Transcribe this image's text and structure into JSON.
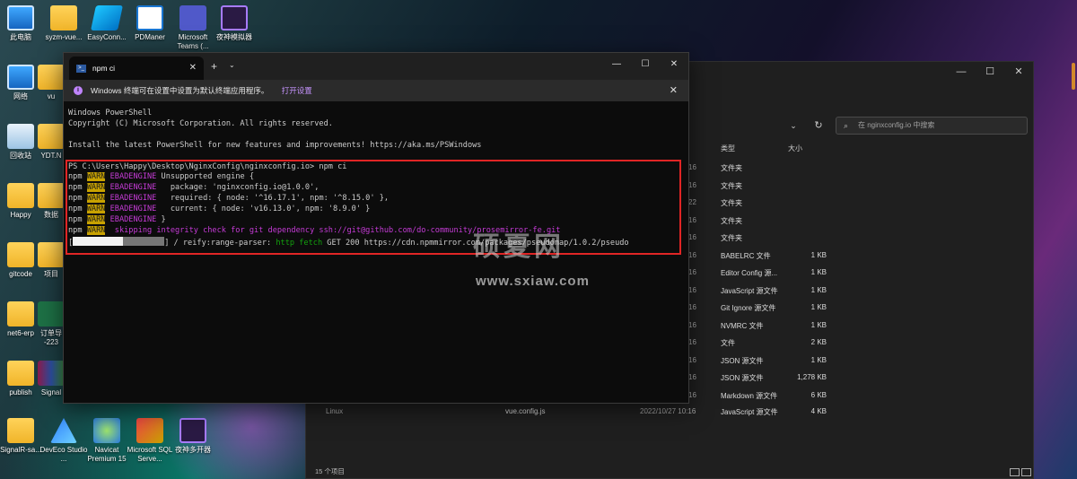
{
  "desktop": {
    "icons": [
      {
        "label": "此电脑",
        "icon": "monitor-icon"
      },
      {
        "label": "syzm-vue...",
        "icon": "folder-icon"
      },
      {
        "label": "EasyConn...",
        "icon": "easyconnect-icon"
      },
      {
        "label": "PDManer",
        "icon": "pdmaner-icon"
      },
      {
        "label": "Microsoft Teams (...",
        "icon": "teams-icon"
      },
      {
        "label": "夜神模拟器",
        "icon": "nox-icon"
      },
      {
        "label": "网络",
        "icon": "network-icon"
      },
      {
        "label": "vu",
        "icon": "folder-icon"
      },
      {
        "label": "回收站",
        "icon": "recycle-bin-icon"
      },
      {
        "label": "YDT.N",
        "icon": "folder-icon"
      },
      {
        "label": "Happy",
        "icon": "folder-icon"
      },
      {
        "label": "数据",
        "icon": "folder-icon"
      },
      {
        "label": "gitcode",
        "icon": "folder-icon"
      },
      {
        "label": "项目",
        "icon": "folder-icon"
      },
      {
        "label": "net6-erp",
        "icon": "folder-icon"
      },
      {
        "label": "订单导 -223",
        "icon": "excel-icon"
      },
      {
        "label": "publish",
        "icon": "folder-icon"
      },
      {
        "label": "Signal",
        "icon": "winrar-icon"
      },
      {
        "label": "SignalR-sa...",
        "icon": "folder-icon"
      },
      {
        "label": "DevEco Studio ...",
        "icon": "deveco-icon"
      },
      {
        "label": "Navicat Premium 15",
        "icon": "navicat-icon"
      },
      {
        "label": "Microsoft SQL Serve...",
        "icon": "sqlserver-icon"
      },
      {
        "label": "夜神多开器",
        "icon": "nox-multi-icon"
      }
    ]
  },
  "terminal": {
    "tab_title": "npm ci",
    "notice_text": "Windows 终端可在设置中设置为默认终端应用程序。",
    "notice_link": "打开设置",
    "header_lines": [
      "Windows PowerShell",
      "Copyright (C) Microsoft Corporation. All rights reserved.",
      "",
      "Install the latest PowerShell for new features and improvements! https://aka.ms/PSWindows",
      ""
    ],
    "prompt": "PS C:\\Users\\Happy\\Desktop\\NginxConfig\\nginxconfig.io> ",
    "command": "npm ci",
    "npm_lines": [
      {
        "prefix": "npm",
        "level": "WARN",
        "code": "EBADENGINE",
        "text": " Unsupported engine {"
      },
      {
        "prefix": "npm",
        "level": "WARN",
        "code": "EBADENGINE",
        "text": "   package: 'nginxconfig.io@1.0.0',"
      },
      {
        "prefix": "npm",
        "level": "WARN",
        "code": "EBADENGINE",
        "text": "   required: { node: '^16.17.1', npm: '^8.15.0' },"
      },
      {
        "prefix": "npm",
        "level": "WARN",
        "code": "EBADENGINE",
        "text": "   current: { node: 'v16.13.0', npm: '8.9.0' }"
      },
      {
        "prefix": "npm",
        "level": "WARN",
        "code": "EBADENGINE",
        "text": " }"
      },
      {
        "prefix": "npm",
        "level": "WARN",
        "code": "",
        "text": " skipping integrity check for git dependency ssh://git@github.com/do-community/prosemirror-fe.git"
      }
    ],
    "progress": {
      "fraction": 0.55,
      "reify_label": "] / reify:range-parser: ",
      "http": "http",
      "fetch": " fetch ",
      "rest": "GET 200 https://cdn.npmmirror.com/packages/pseudomap/1.0.2/pseudo"
    }
  },
  "explorer": {
    "search_placeholder": "在 nginxconfig.io 中搜索",
    "columns": {
      "type": "类型",
      "size": "大小"
    },
    "rows": [
      {
        "date": "16",
        "type": "文件夹",
        "size": ""
      },
      {
        "date": "16",
        "type": "文件夹",
        "size": ""
      },
      {
        "date": "22",
        "type": "文件夹",
        "size": ""
      },
      {
        "date": "16",
        "type": "文件夹",
        "size": ""
      },
      {
        "date": "16",
        "type": "文件夹",
        "size": ""
      },
      {
        "date": "16",
        "type": "BABELRC 文件",
        "size": "1 KB"
      },
      {
        "date": "16",
        "type": "Editor Config 源...",
        "size": "1 KB"
      },
      {
        "date": "16",
        "type": "JavaScript 源文件",
        "size": "1 KB"
      },
      {
        "date": "16",
        "type": "Git Ignore 源文件",
        "size": "1 KB"
      },
      {
        "date": "16",
        "type": "NVMRC 文件",
        "size": "1 KB"
      },
      {
        "date": "16",
        "type": "文件",
        "size": "2 KB"
      },
      {
        "date": "16",
        "type": "JSON 源文件",
        "size": "1 KB"
      },
      {
        "date": "16",
        "type": "JSON 源文件",
        "size": "1,278 KB"
      },
      {
        "date": "16",
        "type": "Markdown 源文件",
        "size": "6 KB"
      }
    ],
    "last_row": {
      "nav": "Linux",
      "name": "vue.config.js",
      "date": "2022/10/27 10:16",
      "type": "JavaScript 源文件",
      "size": "4 KB"
    },
    "status": "15 个项目"
  },
  "watermark": {
    "main": "硕夏网",
    "url": "www.sxiaw.com"
  }
}
